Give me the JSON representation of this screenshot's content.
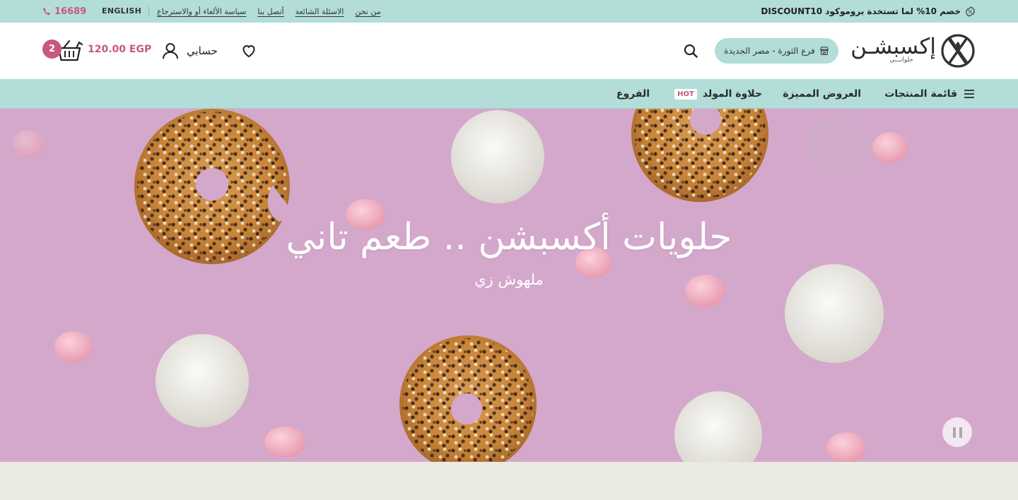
{
  "topbar": {
    "promo": "خصم 10% لما تستخدة بروموكود DISCOUNT10",
    "phone": "16689",
    "language": "ENGLISH",
    "links": [
      "سياسة الألغاء أو والاسترجاع",
      "أتصل بنا",
      "الاسئلة الشائعة",
      "من نحن"
    ]
  },
  "header": {
    "logo_text": "إكسبشـن",
    "logo_sub": "حلوانـــي",
    "branch": "فرع الثورة - مصر الجديدة",
    "account_label": "حسابي",
    "cart_total": "120.00 EGP",
    "cart_count": "2"
  },
  "nav": {
    "menu_label": "قائمة المنتجات",
    "offers_label": "العروض المميزة",
    "mawlid_label": "حلاوة المولد",
    "hot_badge": "HOT",
    "branches_label": "الفروع"
  },
  "hero": {
    "title": "حلويات أكسبشن .. طعم تاني",
    "subtitle": "ملهوش زي"
  },
  "colors": {
    "mint": "#b2ddd8",
    "accent_pink": "#c65a7d",
    "hero_bg": "#d4a8cb",
    "page_bg": "#ecebe2"
  }
}
